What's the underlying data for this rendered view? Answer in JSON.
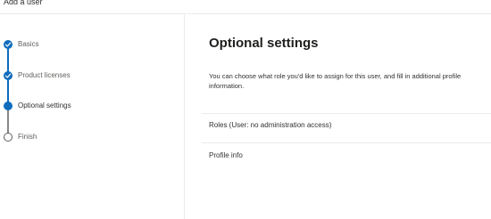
{
  "header": {
    "title": "Add a user"
  },
  "steps": [
    {
      "label": "Basics",
      "state": "done"
    },
    {
      "label": "Product licenses",
      "state": "done"
    },
    {
      "label": "Optional settings",
      "state": "current"
    },
    {
      "label": "Finish",
      "state": "todo"
    }
  ],
  "main": {
    "title": "Optional settings",
    "description": "You can choose what role you'd like to assign for this user, and fill in additional profile information.",
    "sections": [
      {
        "label": "Roles (User: no administration access)"
      },
      {
        "label": "Profile info"
      }
    ]
  },
  "colors": {
    "accent": "#0f6cbd",
    "inactive": "#8a8886",
    "divider": "#edebe9"
  }
}
